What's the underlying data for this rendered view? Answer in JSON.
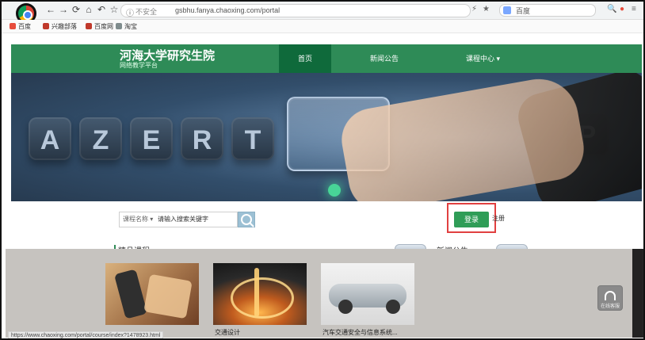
{
  "browser": {
    "url_security": "不安全",
    "url": "gsbhu.fanya.chaoxing.com/portal",
    "search_placeholder": "百度",
    "bookmarks": [
      {
        "label": "百度",
        "color": "#e74c3c"
      },
      {
        "label": "兴趣部落",
        "color": "#c0392b"
      },
      {
        "label": "百度网",
        "color": "#c0392b"
      },
      {
        "label": "淘宝",
        "color": "#7f8c8d"
      }
    ]
  },
  "site": {
    "title": "河海大学研究生院",
    "subtitle": "网络教学平台",
    "nav": {
      "home": "首页",
      "news": "新闻公告",
      "courses": "课程中心"
    },
    "search": {
      "type": "课程名称",
      "value": "请输入搜索关键字"
    },
    "login_label": "登录",
    "register_label": "注册",
    "section_courses_title": "精品课程",
    "section_news_title": "新闻公告",
    "banner_keys": [
      "A",
      "Z",
      "E",
      "R",
      "T",
      "P"
    ],
    "courses": [
      {
        "caption": ""
      },
      {
        "caption": "交通设计"
      },
      {
        "caption": "汽车交通安全与信息系统..."
      }
    ],
    "support_label": "在线客服",
    "status_url": "https://www.chaoxing.com/portal/course/index?1478923.html"
  },
  "colors": {
    "brand_green": "#2e8b57",
    "login_highlight": "#e14040"
  }
}
